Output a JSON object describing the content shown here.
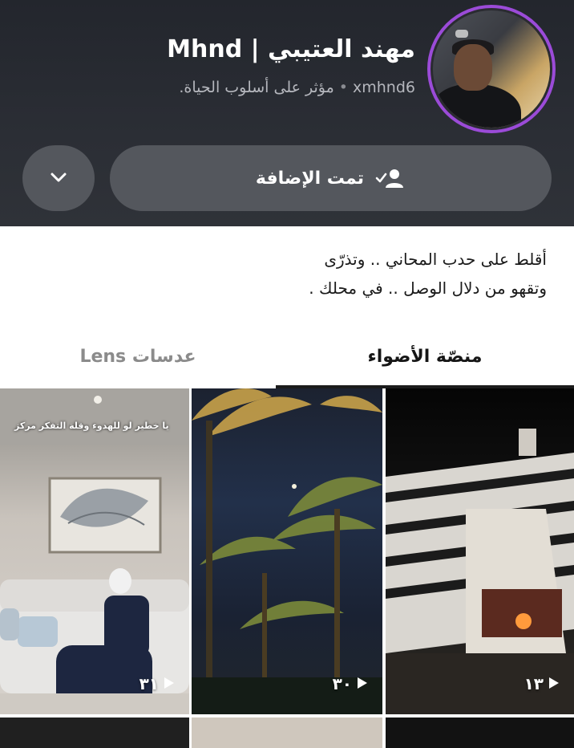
{
  "profile": {
    "display_name": "مهند العتيبي | Mhnd",
    "username": "xmhnd6",
    "category": "مؤثر على أسلوب الحياة",
    "separator": "•",
    "trailing_dot": "."
  },
  "actions": {
    "added_label": "تمت الإضافة",
    "more_icon": "chevron-down-icon"
  },
  "bio": {
    "line1": "أقلط على حدب المحاني .. وتذرّى",
    "line2": "وتقهو من دلال الوصل .. في محلك ."
  },
  "tabs": {
    "spotlight": "منصّة الأضواء",
    "lens": "عدسات Lens"
  },
  "grid": {
    "tiles": [
      {
        "views": "٣١",
        "caption": "يا خطير لو للهدوء وقلة التفكر مركز"
      },
      {
        "views": "٣٠"
      },
      {
        "views": "١٣"
      }
    ]
  },
  "colors": {
    "header_bg": "#2b2e35",
    "avatar_ring": "#9b4bd8",
    "button_bg": "#54575d"
  }
}
